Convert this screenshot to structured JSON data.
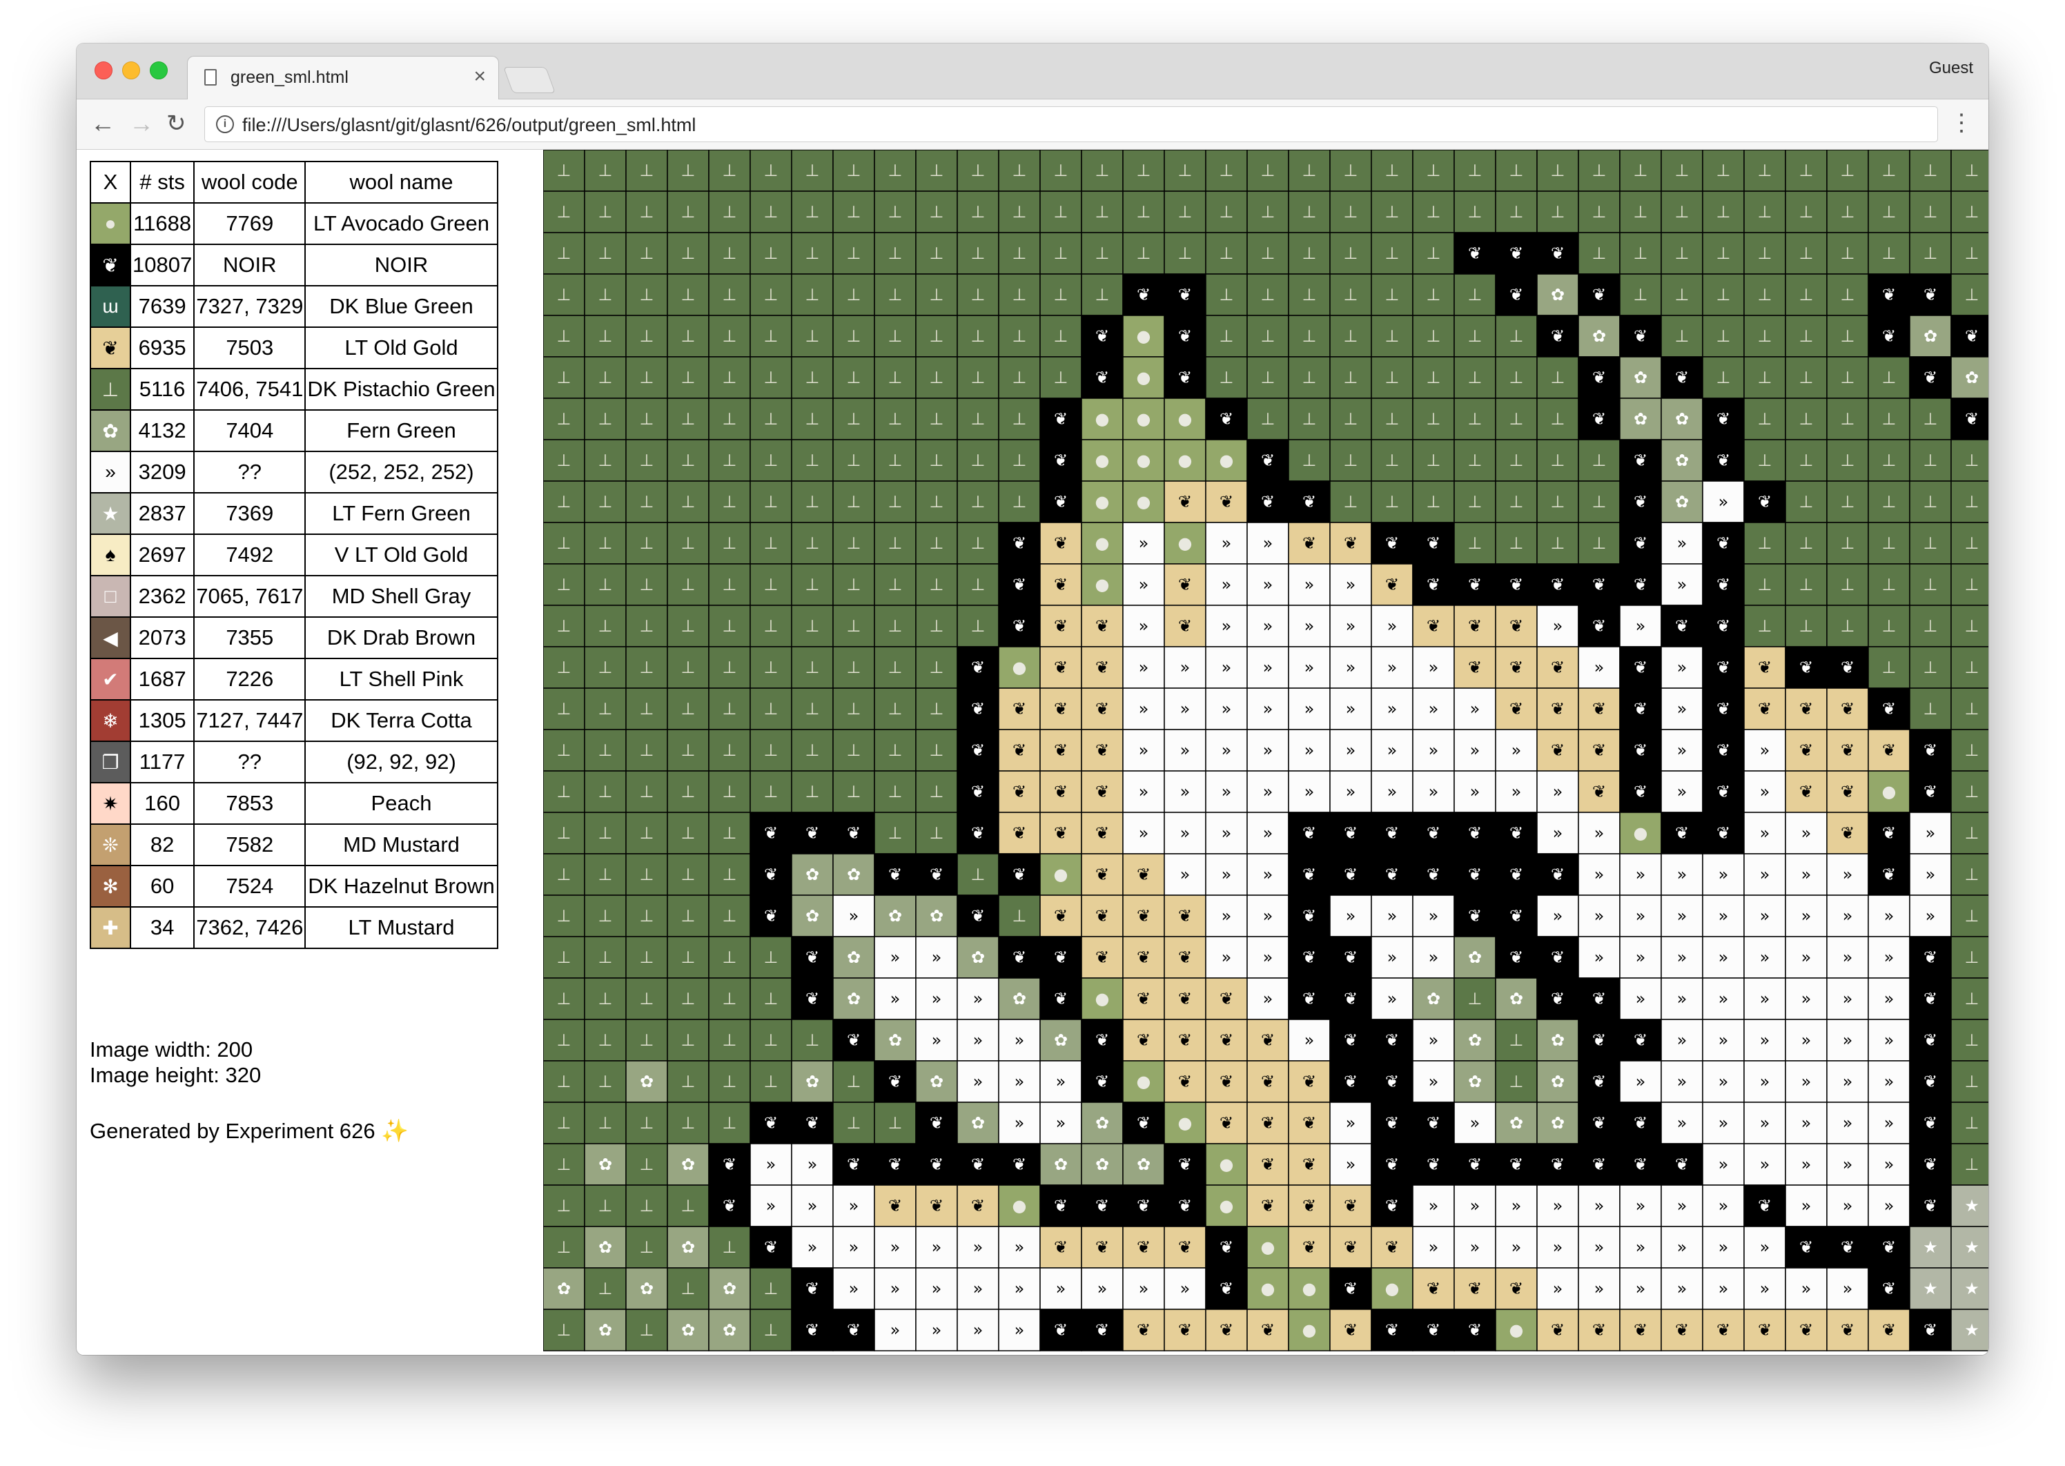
{
  "browser": {
    "tab_title": "green_sml.html",
    "tab_close": "×",
    "profile": "Guest",
    "url": "file:///Users/glasnt/git/glasnt/626/output/green_sml.html",
    "nav": {
      "back": "←",
      "forward": "→",
      "reload": "↻",
      "menu": "⋮",
      "info": "i"
    }
  },
  "legend": {
    "headers": [
      "X",
      "# sts",
      "wool code",
      "wool name"
    ],
    "rows": [
      {
        "symbol": "●",
        "bg": "#94a86a",
        "fg": "#e9e9e0",
        "sts": "11688",
        "code": "7769",
        "name": "LT Avocado Green"
      },
      {
        "symbol": "❦",
        "bg": "#000000",
        "fg": "#ffffff",
        "sts": "10807",
        "code": "NOIR",
        "name": "NOIR"
      },
      {
        "symbol": "ɯ",
        "bg": "#2f6150",
        "fg": "#ffffff",
        "sts": "7639",
        "code": "7327, 7329",
        "name": "DK Blue Green"
      },
      {
        "symbol": "❦",
        "bg": "#e6cf98",
        "fg": "#000000",
        "sts": "6935",
        "code": "7503",
        "name": "LT Old Gold"
      },
      {
        "symbol": "⊥",
        "bg": "#5c7848",
        "fg": "#e2e2d2",
        "sts": "5116",
        "code": "7406, 7541",
        "name": "DK Pistachio Green"
      },
      {
        "symbol": "✿",
        "bg": "#98a682",
        "fg": "#ffffff",
        "sts": "4132",
        "code": "7404",
        "name": "Fern Green"
      },
      {
        "symbol": "»",
        "bg": "#fcfcfc",
        "fg": "#000000",
        "sts": "3209",
        "code": "??",
        "name": "(252, 252, 252)"
      },
      {
        "symbol": "★",
        "bg": "#b2b7a6",
        "fg": "#ffffff",
        "sts": "2837",
        "code": "7369",
        "name": "LT Fern Green"
      },
      {
        "symbol": "♠",
        "bg": "#f7ecc4",
        "fg": "#000000",
        "sts": "2697",
        "code": "7492",
        "name": "V LT Old Gold"
      },
      {
        "symbol": "□",
        "bg": "#c9b7b3",
        "fg": "#ffffff",
        "sts": "2362",
        "code": "7065, 7617",
        "name": "MD Shell Gray"
      },
      {
        "symbol": "◀",
        "bg": "#6b5646",
        "fg": "#ffffff",
        "sts": "2073",
        "code": "7355",
        "name": "DK Drab Brown"
      },
      {
        "symbol": "✔",
        "bg": "#d27b78",
        "fg": "#ffffff",
        "sts": "1687",
        "code": "7226",
        "name": "LT Shell Pink"
      },
      {
        "symbol": "❄",
        "bg": "#a23d33",
        "fg": "#ffffff",
        "sts": "1305",
        "code": "7127, 7447",
        "name": "DK Terra Cotta"
      },
      {
        "symbol": "❐",
        "bg": "#5c5c5c",
        "fg": "#ffffff",
        "sts": "1177",
        "code": "??",
        "name": "(92, 92, 92)"
      },
      {
        "symbol": "✷",
        "bg": "#ffd8c8",
        "fg": "#000000",
        "sts": "160",
        "code": "7853",
        "name": "Peach"
      },
      {
        "symbol": "❊",
        "bg": "#c3a070",
        "fg": "#ffffff",
        "sts": "82",
        "code": "7582",
        "name": "MD Mustard"
      },
      {
        "symbol": "✻",
        "bg": "#9a6140",
        "fg": "#ffffff",
        "sts": "60",
        "code": "7524",
        "name": "DK Hazelnut Brown"
      },
      {
        "symbol": "✚",
        "bg": "#d6bd88",
        "fg": "#ffffff",
        "sts": "34",
        "code": "7362, 7426",
        "name": "LT Mustard"
      }
    ]
  },
  "meta": {
    "width_text": "Image width: 200",
    "height_text": "Image height: 320",
    "generated_text": "Generated by Experiment 626",
    "sparkle": "✨"
  },
  "pattern": {
    "palette": {
      "P": {
        "symbol": "⊥",
        "bg": "#5c7848",
        "fg": "#e2e2d2"
      },
      "N": {
        "symbol": "❦",
        "bg": "#000000",
        "fg": "#ffffff"
      },
      "G": {
        "symbol": "❦",
        "bg": "#e6cf98",
        "fg": "#000000"
      },
      "A": {
        "symbol": "●",
        "bg": "#94a86a",
        "fg": "#e9e9e0"
      },
      "F": {
        "symbol": "✿",
        "bg": "#98a682",
        "fg": "#ffffff"
      },
      "W": {
        "symbol": "»",
        "bg": "#fcfcfc",
        "fg": "#000000"
      },
      "S": {
        "symbol": "★",
        "bg": "#b2b7a6",
        "fg": "#ffffff"
      }
    },
    "rows": [
      "PPPPPPPPPPPPPPPPPPPPPPPPPPPPPPPPPPP",
      "PPPPPPPPPPPPPPPPPPPPPPPPPPPPPPPPPPP",
      "PPPPPPPPPPPPPPPPPPPPPPNNNPPPPPPPPPP",
      "PPPPPPPPPPPPPPNNPPPPPPPNFNPPPPPPNNP",
      "PPPPPPPPPPPPPNANPPPPPPPPNFNPPPPPNFN",
      "PPPPPPPPPPPPPNANPPPPPPPPPNFNPPPPPNF",
      "PPPPPPPPPPPPNAAANPPPPPPPPNFFNPPPPPN",
      "PPPPPPPPPPPPNAAAANPPPPPPPPNFNPPPPPP",
      "PPPPPPPPPPPPNAAGGNNPPPPPPPNFWNPPPPP",
      "PPPPPPPPPPPNGAWAWWGGNNPPPPNWNPPPPPP",
      "PPPPPPPPPPPNGAWGWWWWGNNNNNNWNPPPPPP",
      "PPPPPPPPPPPNGGWGWWWWWGGGWNWNNPPPPPP",
      "PPPPPPPPPPNAGGWWWWWWWWGGGWNWNGNNPPP",
      "PPPPPPPPPPNGGGWWWWWWWWWGGGNWNGGGNPP",
      "PPPPPPPPPPNGGGWWWWWWWWWWGGNWNWGGGNP",
      "PPPPPPPPPPNGGGWWWWWWWWWWWGNWNWGGANP",
      "PPPPPNNNPPNGGGWWWWNNNNNNWWANNWWGNWP",
      "PPPPPNFFNNPNAGGWWWNNNNNNNWWWWWWWNWP",
      "PPPPPNFWFFNPGGGGWWNWWWNNWWWWWWWWWWP",
      "PPPPPPNFWWFNNGGGWWNNWWFNNWWWWWWWWNP",
      "PPPPPPNFWWWFNAGGGWNNWFPFNNWWWWWWWNP",
      "PPPPPPPNFWWWFNGGGGWNNWFPFNNWWWWWWNP",
      "PPFPPPFPNFWWWNAGGGGNNWFPFNWWWWWWWNP",
      "PPPPPNNPPNFWWFNAGGGWNNWFFNNWWWWWWNP",
      "PFPFNWWNNNNNFFFNAGGWNNNNNNNNWWWWWNP",
      "PPPPNWWWGGGANNNNAGGGNWWWWWWWWNWWWNS",
      "PFPFPNWWWWWWGGGGNAGGGWWWWWWWWWNNNSS",
      "FPFPFPNWWWWWWWWWNAANAGGGWWWWWWWWNSS",
      "PFPFFPNNWWWWNNGGGGAGNNNAGGGGGGGGGNSS"
    ]
  }
}
